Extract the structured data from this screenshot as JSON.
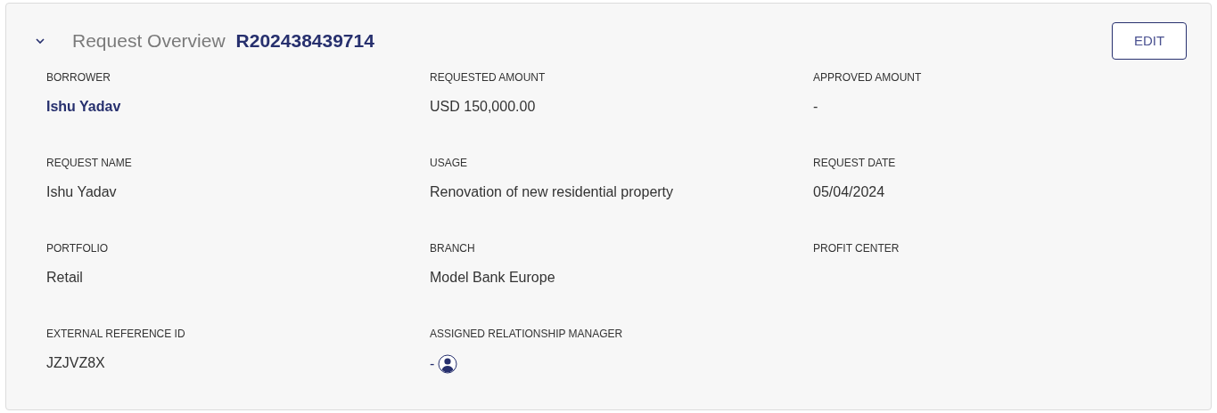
{
  "header": {
    "expanded": true,
    "title": "Request Overview",
    "reference": "R202438439714",
    "edit_button": "EDIT"
  },
  "fields": [
    {
      "label": "BORROWER",
      "value": "Ishu Yadav",
      "kind": "link"
    },
    {
      "label": "REQUESTED AMOUNT",
      "value": "USD 150,000.00",
      "kind": "text"
    },
    {
      "label": "APPROVED AMOUNT",
      "value": "-",
      "kind": "text"
    },
    {
      "label": "REQUEST NAME",
      "value": "Ishu Yadav",
      "kind": "text"
    },
    {
      "label": "USAGE",
      "value": "Renovation of new residential property",
      "kind": "text"
    },
    {
      "label": "REQUEST DATE",
      "value": "05/04/2024",
      "kind": "text"
    },
    {
      "label": "PORTFOLIO",
      "value": "Retail",
      "kind": "text"
    },
    {
      "label": "BRANCH",
      "value": "Model Bank Europe",
      "kind": "text"
    },
    {
      "label": "PROFIT CENTER"
    },
    {
      "label": "EXTERNAL REFERENCE ID",
      "value": "JZJVZ8X",
      "kind": "text"
    },
    {
      "label": "ASSIGNED RELATIONSHIP MANAGER",
      "value": "-",
      "kind": "manager"
    }
  ]
}
